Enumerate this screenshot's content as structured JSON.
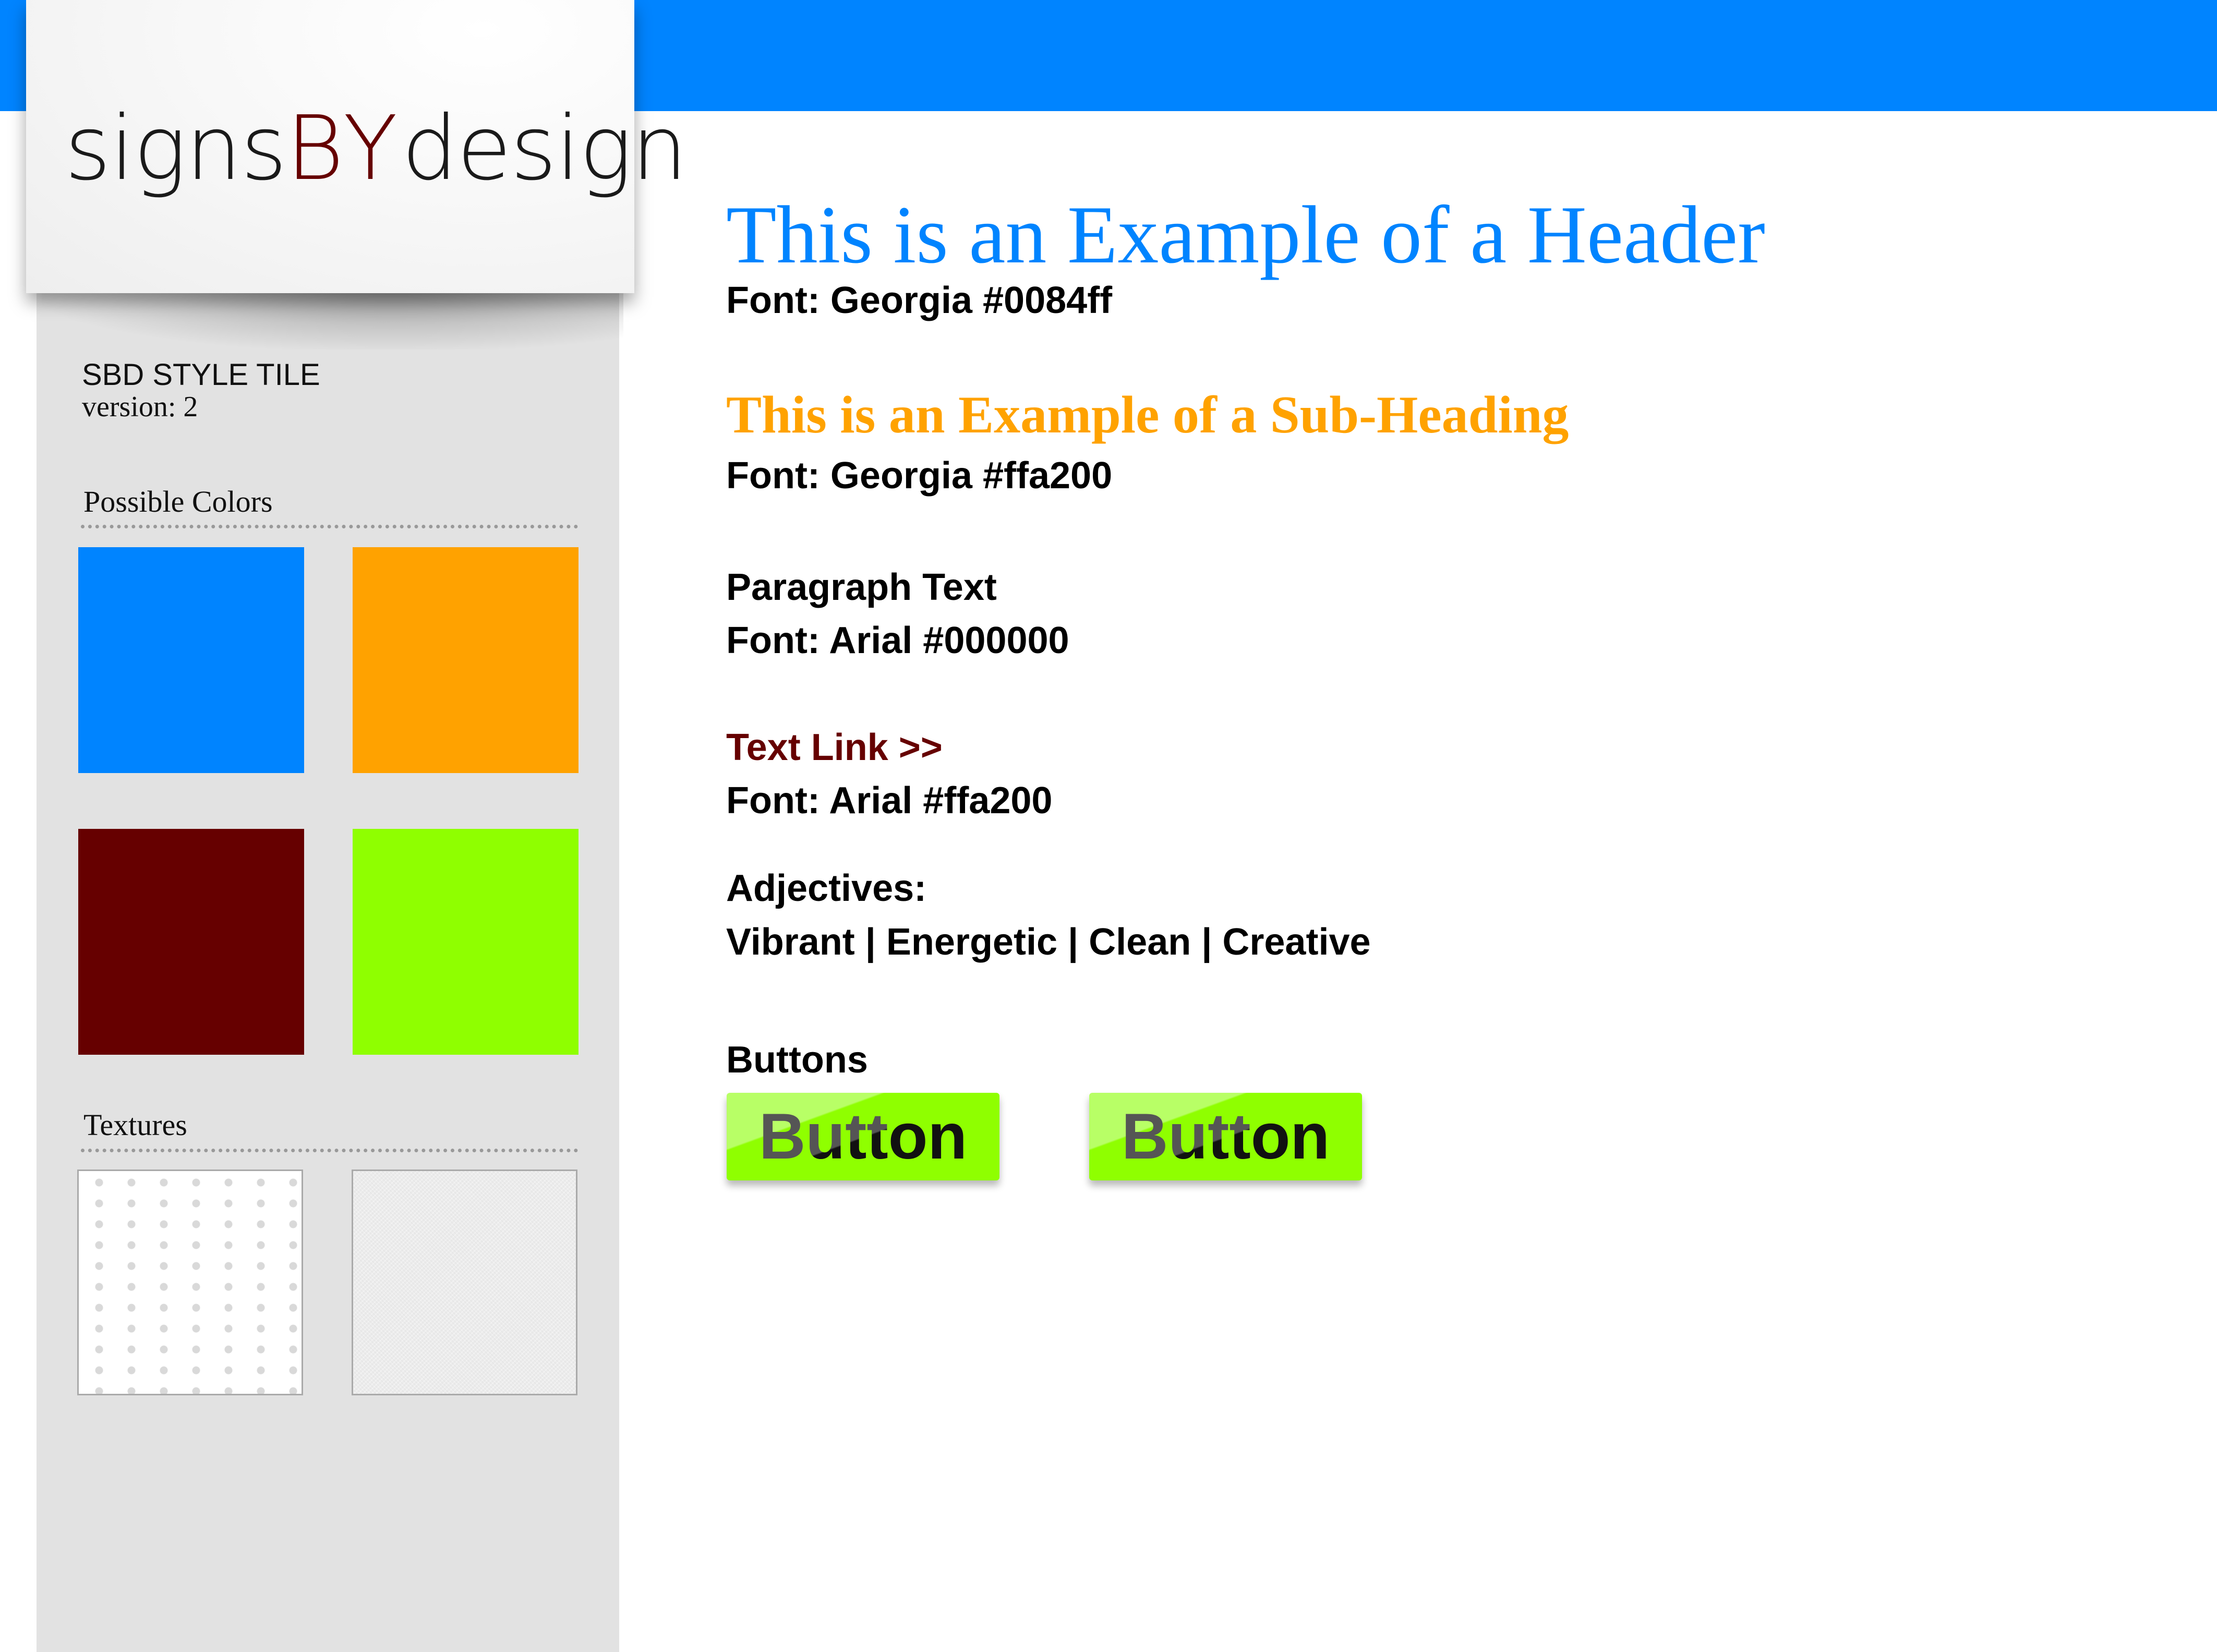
{
  "brand": {
    "logo_left": "signs",
    "logo_mid": "BY",
    "logo_right": "design"
  },
  "sidebar": {
    "title": "SBD STYLE TILE",
    "version": "version: 2",
    "colors_label": "Possible Colors",
    "colors": [
      {
        "name": "blue",
        "hex": "#0084ff"
      },
      {
        "name": "orange",
        "hex": "#ffa200"
      },
      {
        "name": "maroon",
        "hex": "#660000"
      },
      {
        "name": "green",
        "hex": "#8fff00"
      }
    ],
    "textures_label": "Textures"
  },
  "main": {
    "header": "This is an Example of a Header",
    "header_font": "Font: Georgia #0084ff",
    "subheading": "This is an Example of a Sub-Heading",
    "subheading_font": "Font: Georgia #ffa200",
    "paragraph_label": "Paragraph Text",
    "paragraph_font": "Font: Arial #000000",
    "link_text": "Text Link >>",
    "link_font": "Font: Arial #ffa200",
    "adjectives_label": "Adjectives:",
    "adjectives": "Vibrant | Energetic | Clean | Creative",
    "buttons_label": "Buttons",
    "buttons": [
      {
        "label": "Button"
      },
      {
        "label": "Button"
      }
    ]
  },
  "theme": {
    "top_bar": "#0084ff",
    "sidebar_bg": "#e2e2e2"
  }
}
